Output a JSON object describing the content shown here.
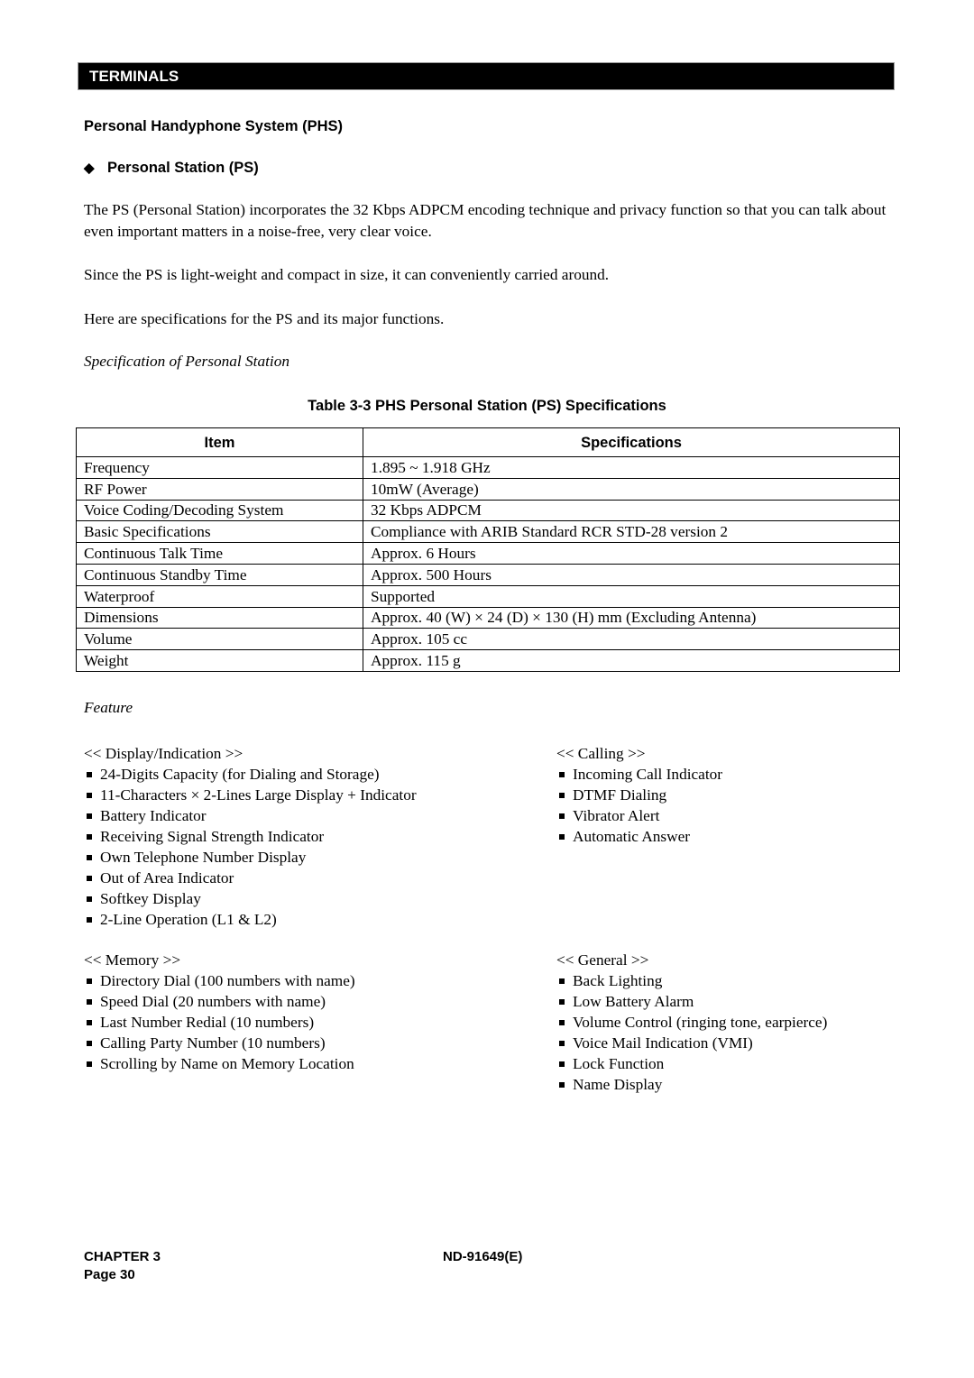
{
  "section_bar": "TERMINALS",
  "heading": "Personal Handyphone System (PHS)",
  "subheading": {
    "bullet": "◆",
    "text": "Personal Station (PS)"
  },
  "paragraphs": [
    "The PS (Personal Station) incorporates the 32 Kbps ADPCM encoding technique and privacy function so that you can talk about even important matters in a noise-free, very clear voice.",
    "Since the PS is light-weight and compact in size, it can conveniently carried around.",
    "Here are specifications for the PS and its major functions."
  ],
  "spec_subtitle": "Specification of Personal Station",
  "table": {
    "caption": "Table 3-3  PHS Personal Station (PS) Specifications",
    "headers": [
      "Item",
      "Specifications"
    ],
    "rows": [
      [
        "Frequency",
        "1.895 ~ 1.918 GHz"
      ],
      [
        "RF Power",
        "10mW (Average)"
      ],
      [
        "Voice Coding/Decoding System",
        "32 Kbps ADPCM"
      ],
      [
        "Basic Specifications",
        "Compliance with ARIB Standard RCR STD-28 version 2"
      ],
      [
        "Continuous Talk Time",
        "Approx. 6 Hours"
      ],
      [
        "Continuous Standby Time",
        "Approx. 500 Hours"
      ],
      [
        "Waterproof",
        "Supported"
      ],
      [
        "Dimensions",
        "Approx. 40 (W) × 24 (D) × 130 (H) mm (Excluding Antenna)"
      ],
      [
        "Volume",
        "Approx. 105 cc"
      ],
      [
        "Weight",
        "Approx. 115 g"
      ]
    ]
  },
  "feature_title": "Feature",
  "features": {
    "display": {
      "header": "<< Display/Indication >>",
      "items": [
        "24-Digits Capacity (for Dialing and Storage)",
        "11-Characters × 2-Lines Large Display + Indicator",
        "Battery Indicator",
        "Receiving Signal Strength Indicator",
        "Own Telephone Number Display",
        "Out of Area Indicator",
        "Softkey Display",
        "2-Line Operation (L1 & L2)"
      ]
    },
    "calling": {
      "header": "<< Calling >>",
      "items": [
        "Incoming Call Indicator",
        "DTMF Dialing",
        "Vibrator Alert",
        "Automatic Answer"
      ]
    },
    "memory": {
      "header": "<< Memory >>",
      "items": [
        "Directory Dial (100 numbers with name)",
        "Speed Dial (20 numbers with name)",
        "Last Number Redial (10 numbers)",
        "Calling Party Number (10 numbers)",
        "Scrolling by Name on Memory Location"
      ]
    },
    "general": {
      "header": "<< General >>",
      "items": [
        "Back Lighting",
        "Low Battery Alarm",
        "Volume Control (ringing tone, earpierce)",
        "Voice Mail Indication (VMI)",
        "Lock Function",
        "Name Display"
      ]
    }
  },
  "footer": {
    "chapter": "CHAPTER 3",
    "page": "Page 30",
    "doc_id": "ND-91649(E)"
  }
}
